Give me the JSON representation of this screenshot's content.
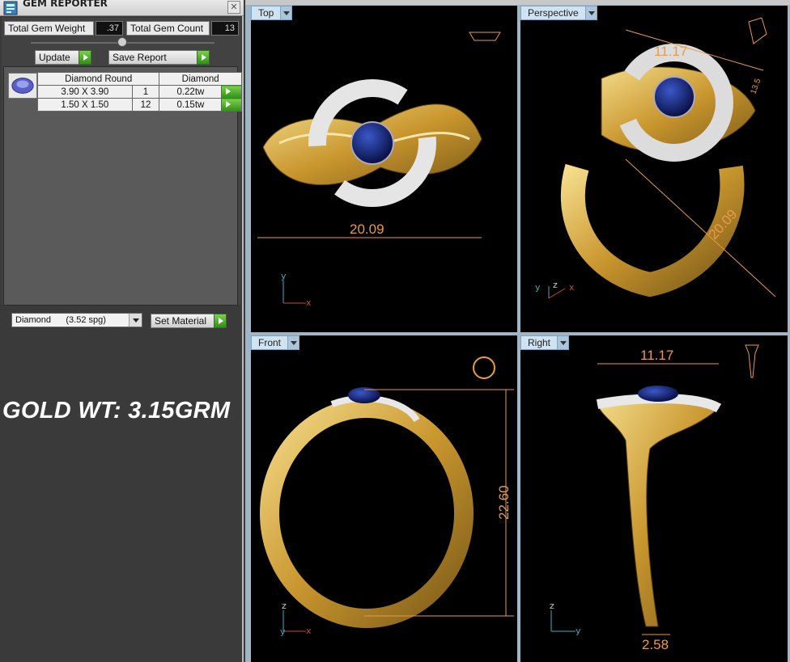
{
  "app": {
    "title": "GEM REPORTER"
  },
  "stats": {
    "total_weight_label": "Total Gem Weight",
    "total_weight_value": ".37",
    "total_count_label": "Total Gem Count",
    "total_count_value": "13"
  },
  "buttons": {
    "update": "Update",
    "save_report": "Save Report",
    "set_material": "Set Material"
  },
  "gem_table": {
    "headers": [
      "Diamond Round",
      "Diamond"
    ],
    "rows": [
      {
        "size": "3.90 X 3.90",
        "count": "1",
        "weight": "0.22tw"
      },
      {
        "size": "1.50 X 1.50",
        "count": "12",
        "weight": "0.15tw"
      }
    ]
  },
  "material": {
    "selected": "Diamond      (3.52 spg)"
  },
  "gold_weight": "GOLD WT: 3.15GRM",
  "viewports": [
    {
      "label": "Top",
      "dimensions": [
        "20.09"
      ]
    },
    {
      "label": "Perspective",
      "dimensions": [
        "11.17",
        "20.09",
        "13.5"
      ]
    },
    {
      "label": "Front",
      "dimensions": [
        "22.60"
      ]
    },
    {
      "label": "Right",
      "dimensions": [
        "11.17",
        "2.58"
      ]
    }
  ],
  "axes": {
    "x": "x",
    "y": "y",
    "z": "z"
  },
  "colors": {
    "gold": "#d8b24a",
    "sapphire": "#0d1e6e",
    "dimension": "#e89a4a",
    "viewport_border": "#9fb6c8"
  }
}
